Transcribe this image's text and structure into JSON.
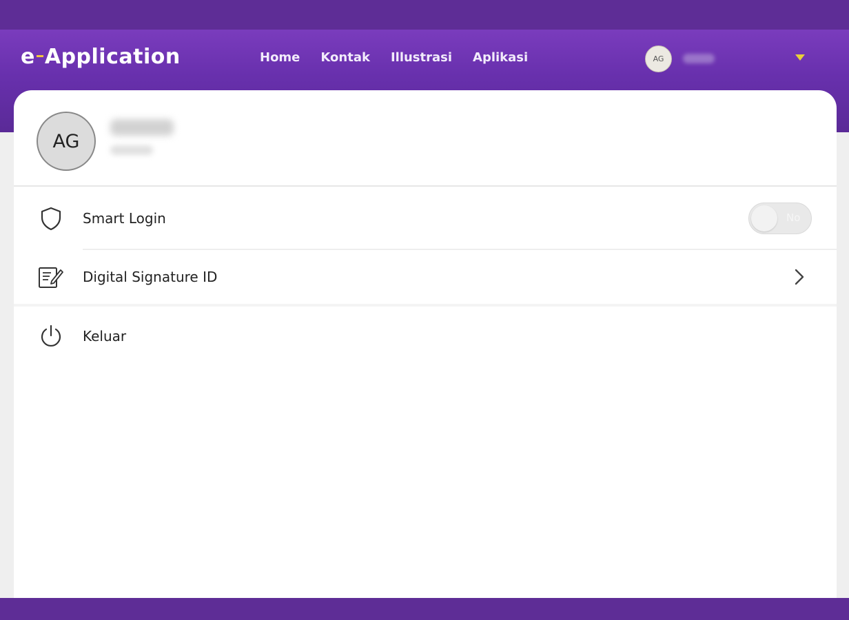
{
  "app": {
    "logo_prefix": "e",
    "logo_suffix": "Application",
    "logo_accent_color": "#f2c53d",
    "brand_color": "#5e2d96"
  },
  "nav": {
    "items": [
      {
        "label": "Home"
      },
      {
        "label": "Kontak"
      },
      {
        "label": "Illustrasi"
      },
      {
        "label": "Aplikasi"
      }
    ]
  },
  "user_chip": {
    "initials": "AG",
    "dropdown_icon": "caret-down-icon"
  },
  "profile": {
    "initials": "AG"
  },
  "menu": {
    "smart_login": {
      "label": "Smart Login",
      "icon": "shield-icon",
      "toggle_text": "No",
      "toggle_on": false
    },
    "digital_signature": {
      "label": "Digital Signature ID",
      "icon": "signature-document-icon",
      "trailing_icon": "chevron-right-icon"
    },
    "logout": {
      "label": "Keluar",
      "icon": "power-icon"
    }
  }
}
